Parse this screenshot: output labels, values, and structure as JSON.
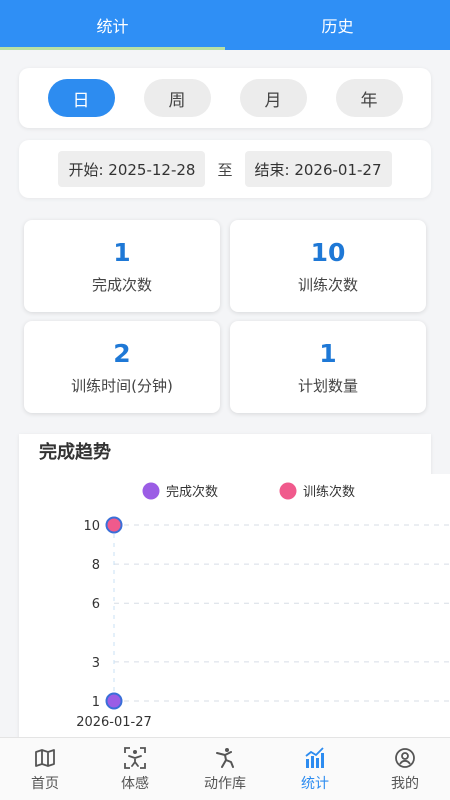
{
  "tabs": [
    {
      "label": "统计",
      "active": true
    },
    {
      "label": "历史",
      "active": false
    }
  ],
  "periods": [
    {
      "label": "日",
      "active": true
    },
    {
      "label": "周",
      "active": false
    },
    {
      "label": "月",
      "active": false
    },
    {
      "label": "年",
      "active": false
    }
  ],
  "range": {
    "start": "开始: 2025-12-28",
    "separator": "至",
    "end": "结束: 2026-01-27"
  },
  "stats": [
    {
      "value": "1",
      "label": "完成次数"
    },
    {
      "value": "10",
      "label": "训练次数"
    },
    {
      "value": "2",
      "label": "训练时间(分钟)"
    },
    {
      "value": "1",
      "label": "计划数量"
    }
  ],
  "trend": {
    "title": "完成趋势"
  },
  "chart_data": {
    "type": "line",
    "title": "完成趋势",
    "x": [
      "2026-01-27"
    ],
    "series": [
      {
        "name": "完成次数",
        "values": [
          1
        ],
        "color": "#9b5de5"
      },
      {
        "name": "训练次数",
        "values": [
          10
        ],
        "color": "#f05a8c"
      }
    ],
    "y_ticks": [
      1,
      3,
      6,
      8,
      10
    ],
    "ylim": [
      1,
      10
    ],
    "grid": true,
    "legend": "top"
  },
  "nav": [
    {
      "label": "首页",
      "icon": "map-icon",
      "active": false
    },
    {
      "label": "体感",
      "icon": "motion-sense-icon",
      "active": false
    },
    {
      "label": "动作库",
      "icon": "exercise-icon",
      "active": false
    },
    {
      "label": "统计",
      "icon": "bar-chart-icon",
      "active": true
    },
    {
      "label": "我的",
      "icon": "user-icon",
      "active": false
    }
  ],
  "colors": {
    "primary": "#2f8ff5",
    "stat_value": "#1e78d6",
    "tab_indicator": "#b8e0a4"
  }
}
